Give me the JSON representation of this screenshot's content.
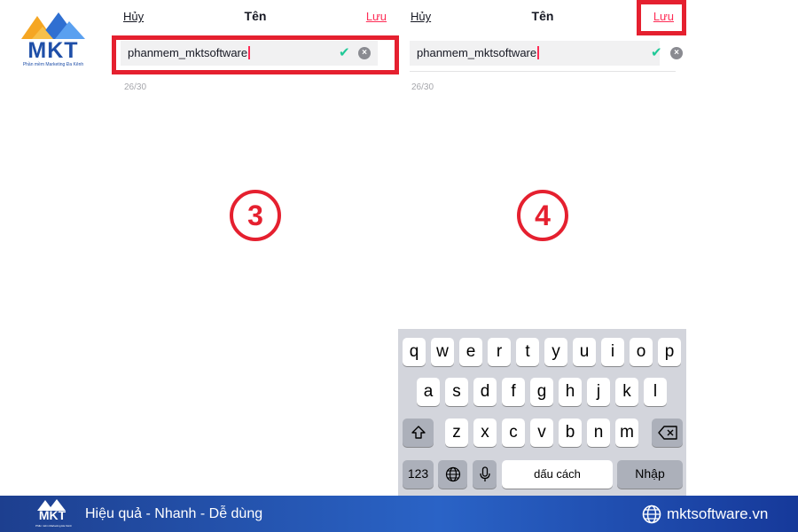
{
  "brand": {
    "logo_text": "MKT",
    "logo_tagline": "Phần mềm Marketing Đa Kênh",
    "colors": {
      "primary": "#1f4fa8",
      "accent_red": "#e5202f",
      "tiktok_red": "#fe2c55",
      "check_green": "#20c997"
    }
  },
  "screens": [
    {
      "step": "3",
      "cancel_label": "Hủy",
      "title": "Tên",
      "save_label": "Lưu",
      "input_value": "phanmem_mktsoftware",
      "counter": "26/30"
    },
    {
      "step": "4",
      "cancel_label": "Hủy",
      "title": "Tên",
      "save_label": "Lưu",
      "input_value": "phanmem_mktsoftware",
      "counter": "26/30"
    }
  ],
  "keyboard": {
    "row1": [
      "q",
      "w",
      "e",
      "r",
      "t",
      "y",
      "u",
      "i",
      "o",
      "p"
    ],
    "row2": [
      "a",
      "s",
      "d",
      "f",
      "g",
      "h",
      "j",
      "k",
      "l"
    ],
    "row3": [
      "z",
      "x",
      "c",
      "v",
      "b",
      "n",
      "m"
    ],
    "numbers_label": "123",
    "space_label": "dấu cách",
    "return_label": "Nhập",
    "shift_icon": "shift-icon",
    "backspace_icon": "backspace-icon",
    "globe_icon": "globe-icon",
    "mic_icon": "microphone-icon"
  },
  "footer": {
    "logo_text": "MKT",
    "logo_tagline": "Phần mềm Marketing Đa Kênh",
    "slogan": "Hiệu quả - Nhanh - Dễ dùng",
    "website": "mktsoftware.vn"
  }
}
